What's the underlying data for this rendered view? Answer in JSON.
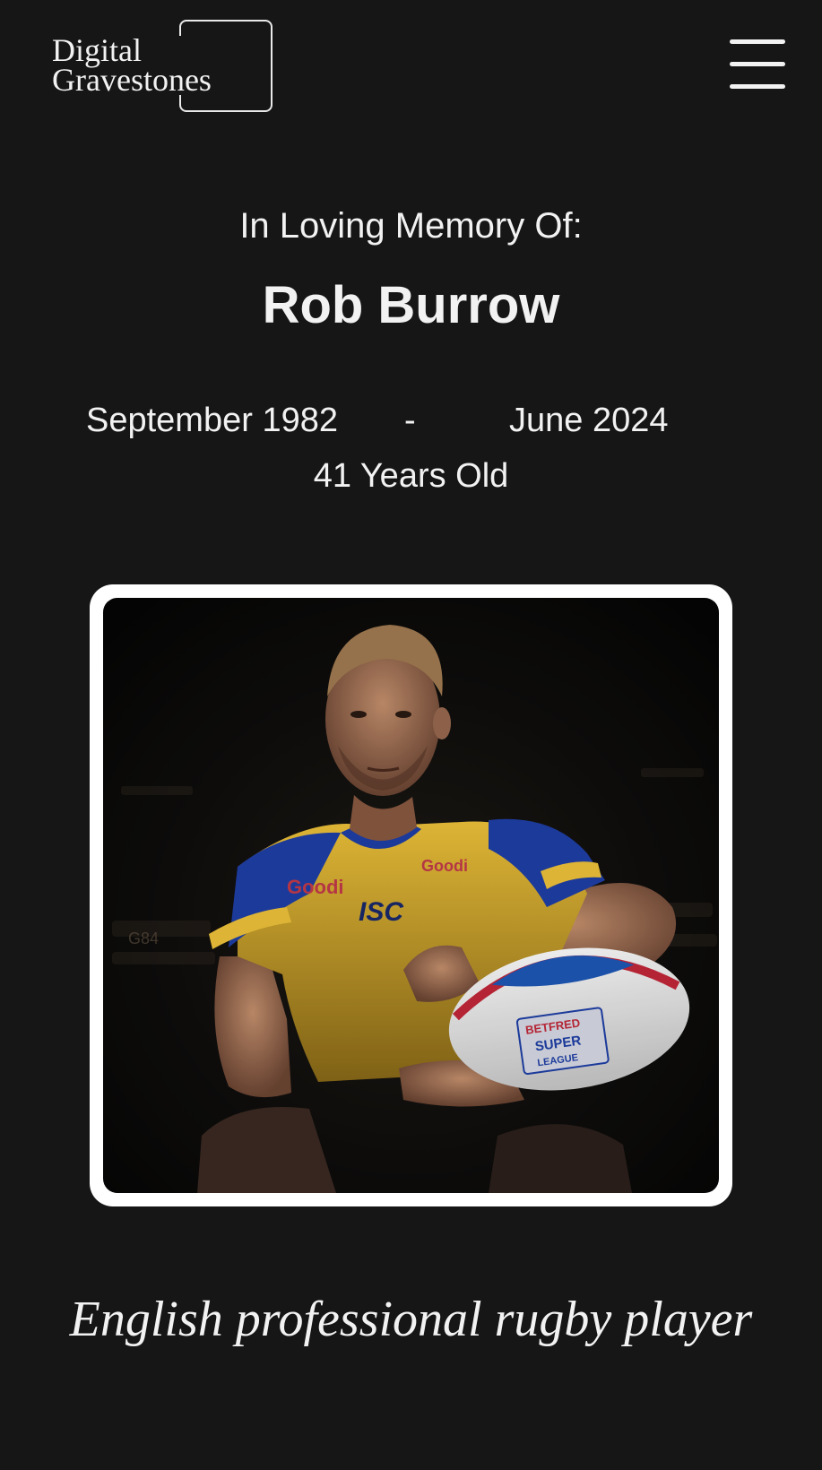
{
  "header": {
    "logo": {
      "line1": "Digital",
      "line2": "Gravestones"
    },
    "menu_icon": "hamburger-menu-icon"
  },
  "memorial": {
    "heading": "In Loving Memory Of:",
    "name": "Rob Burrow",
    "birth": "September 1982",
    "separator": "-",
    "death": "June 2024",
    "age": "41 Years Old",
    "description": "English professional rugby player"
  },
  "photo": {
    "jersey_sponsors": [
      "ISC",
      "Goodi",
      "BETFRED SUPER LEAGUE"
    ],
    "colors": {
      "jersey_yellow": "#f0c43a",
      "jersey_blue": "#1f3fa8",
      "background": "#0b0b0b"
    }
  },
  "colors": {
    "page_background": "#161616",
    "text": "#f2f2f2",
    "frame": "#ffffff"
  }
}
